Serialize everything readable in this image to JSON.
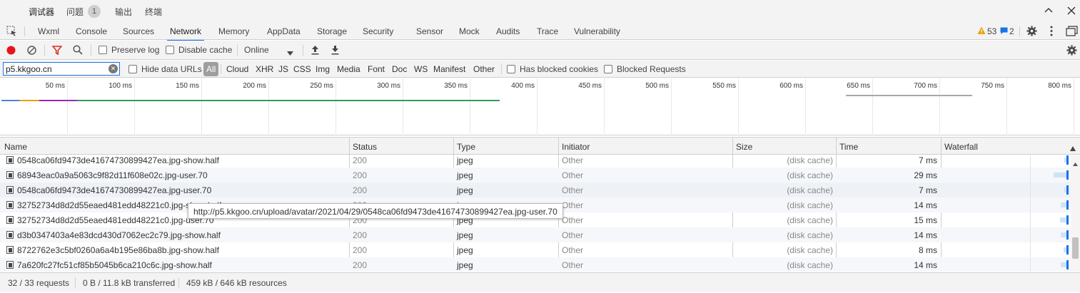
{
  "top_tabs": [
    "调试器",
    "问题",
    "输出",
    "终端"
  ],
  "issues_count": "1",
  "panel_tabs": [
    "Wxml",
    "Console",
    "Sources",
    "Network",
    "Memory",
    "AppData",
    "Storage",
    "Security",
    "Sensor",
    "Mock",
    "Audits",
    "Trace",
    "Vulnerability"
  ],
  "active_panel_tab": "Network",
  "warnings_count": "53",
  "messages_count": "2",
  "toolbar": {
    "preserve_log": "Preserve log",
    "disable_cache": "Disable cache",
    "throttle": "Online"
  },
  "filter": {
    "value": "p5.kkgoo.cn",
    "hide_data_urls": "Hide data URLs",
    "types": [
      "All",
      "Cloud",
      "XHR",
      "JS",
      "CSS",
      "Img",
      "Media",
      "Font",
      "Doc",
      "WS",
      "Manifest",
      "Other"
    ],
    "has_blocked_cookies": "Has blocked cookies",
    "blocked_requests": "Blocked Requests"
  },
  "overview_ticks": [
    "50 ms",
    "100 ms",
    "150 ms",
    "200 ms",
    "250 ms",
    "300 ms",
    "350 ms",
    "400 ms",
    "450 ms",
    "500 ms",
    "550 ms",
    "600 ms",
    "650 ms",
    "700 ms",
    "750 ms",
    "800 ms"
  ],
  "columns": [
    "Name",
    "Status",
    "Type",
    "Initiator",
    "Size",
    "Time",
    "Waterfall"
  ],
  "colors": {
    "accent": "#1a73e8",
    "record": "#e5141a",
    "filter": "#d93025",
    "warning": "#e8a000"
  },
  "requests": [
    {
      "name": "0548ca06fd9473de41674730899427ea.jpg-show.half",
      "status": "200",
      "type": "jpeg",
      "initiator": "Other",
      "size": "(disk cache)",
      "time": "7 ms",
      "time_ms": 7
    },
    {
      "name": "68943eac0a9a5063c9f82d11f608e02c.jpg-user.70",
      "status": "200",
      "type": "jpeg",
      "initiator": "Other",
      "size": "(disk cache)",
      "time": "29 ms",
      "time_ms": 29
    },
    {
      "name": "0548ca06fd9473de41674730899427ea.jpg-user.70",
      "status": "200",
      "type": "jpeg",
      "initiator": "Other",
      "size": "(disk cache)",
      "time": "7 ms",
      "time_ms": 7
    },
    {
      "name": "32752734d8d2d55eaed481edd48221c0.jpg-show.half",
      "status": "200",
      "type": "jpeg",
      "initiator": "Other",
      "size": "(disk cache)",
      "time": "14 ms",
      "time_ms": 14
    },
    {
      "name": "32752734d8d2d55eaed481edd48221c0.jpg-user.70",
      "status": "200",
      "type": "jpeg",
      "initiator": "Other",
      "size": "(disk cache)",
      "time": "15 ms",
      "time_ms": 15
    },
    {
      "name": "d3b0347403a4e83dcd430d7062ec2c79.jpg-show.half",
      "status": "200",
      "type": "jpeg",
      "initiator": "Other",
      "size": "(disk cache)",
      "time": "14 ms",
      "time_ms": 14
    },
    {
      "name": "8722762e3c5bf0260a6a4b195e86ba8b.jpg-show.half",
      "status": "200",
      "type": "jpeg",
      "initiator": "Other",
      "size": "(disk cache)",
      "time": "8 ms",
      "time_ms": 8
    },
    {
      "name": "7a620fc27fc51cf85b5045b6ca210c6c.jpg-show.half",
      "status": "200",
      "type": "jpeg",
      "initiator": "Other",
      "size": "(disk cache)",
      "time": "14 ms",
      "time_ms": 14
    }
  ],
  "tooltip": "http://p5.kkgoo.cn/upload/avatar/2021/04/29/0548ca06fd9473de41674730899427ea.jpg-user.70",
  "status": {
    "requests": "32 / 33 requests",
    "transferred": "0 B / 11.8 kB transferred",
    "resources": "459 kB / 646 kB resources"
  }
}
